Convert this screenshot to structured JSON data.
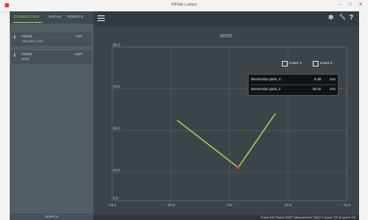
{
  "window": {
    "title": "RIFtek Lanica",
    "controls": {
      "minimize": "–",
      "maximize": "□",
      "close": "✕"
    }
  },
  "sidebar": {
    "tabs": [
      {
        "label": "CONNECTION",
        "active": true
      },
      {
        "label": "MATHS",
        "active": false
      },
      {
        "label": "ROBOTS",
        "active": false
      }
    ],
    "connections": [
      {
        "icon": "i",
        "name": "RF625",
        "address": "192.168.1.100",
        "protocol": "TCP"
      },
      {
        "icon": "i",
        "name": "RF625",
        "address": "6003",
        "protocol": "UDP"
      }
    ],
    "search_label": "SEARCH"
  },
  "toolbar": {
    "icons": [
      "menu-icon",
      "gear-icon",
      "wrench-icon",
      "help-icon"
    ],
    "settings": "✲",
    "tools": "🔧",
    "help": "?"
  },
  "chart": {
    "title": "RF625",
    "checkboxes": [
      {
        "label": "Invert X",
        "checked": false
      },
      {
        "label": "Invert Z",
        "checked": false
      }
    ],
    "intersection": [
      {
        "label": "intersection point, X",
        "value": "5.48",
        "unit": "mm"
      },
      {
        "label": "intersection point, Z",
        "value": "26.92",
        "unit": "mm"
      }
    ]
  },
  "chart_data": {
    "type": "line",
    "title": "RF625",
    "xlim": [
      -74.0,
      74.0
    ],
    "ylim": [
      8.0,
      96.0
    ],
    "x_ticks": [
      "-74.0",
      "-37.0",
      "0.0",
      "37.0",
      "74.0"
    ],
    "y_ticks": [
      "96.0",
      "72.0",
      "48.0",
      "24.0",
      "8.0"
    ],
    "y_tick_values": [
      96,
      72,
      48,
      24,
      8
    ],
    "x_tick_values": [
      -74,
      -37,
      0,
      37,
      74
    ],
    "grid": true,
    "series": [
      {
        "color": "#a8d84e",
        "x": [
          -33,
          5.48
        ],
        "y": [
          54,
          26.92
        ]
      },
      {
        "color": "#a8d84e",
        "x": [
          5.48,
          29
        ],
        "y": [
          26.92,
          58
        ]
      }
    ],
    "intersection_point": {
      "x": 5.48,
      "y": 26.92,
      "color": "#e53935"
    }
  },
  "status": {
    "text": "Points 645 Packet 32987 Measurement 73612 X speed 700 M speed 700"
  },
  "colors": {
    "accent": "#9bd24a",
    "sidebar": "#535d64",
    "plot_bg": "#3c4349",
    "series": "#a8d84e",
    "point": "#e53935"
  }
}
